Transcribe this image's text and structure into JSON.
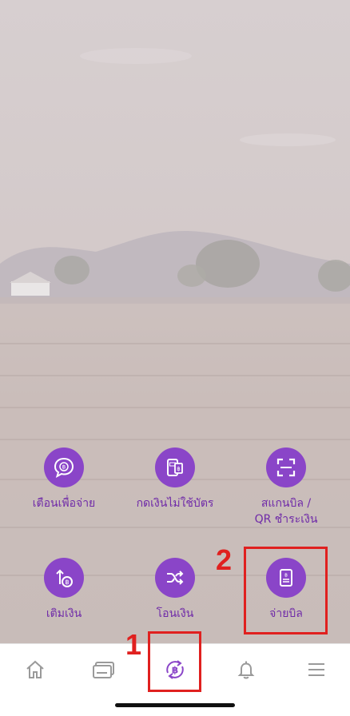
{
  "actions": {
    "remind_pay": "เตือนเพื่อจ่าย",
    "cardless_withdraw": "กดเงินไม่ใช้บัตร",
    "scan_bill": "สแกนบิล /\nQR ชำระเงิน",
    "top_up": "เติมเงิน",
    "transfer": "โอนเงิน",
    "pay_bill": "จ่ายบิล"
  },
  "annotations": {
    "step1": "1",
    "step2": "2"
  },
  "tabbar": {
    "items": [
      "home-icon",
      "card-icon",
      "baht-exchange-icon",
      "bell-icon",
      "menu-icon"
    ],
    "selected": "baht-exchange-icon"
  },
  "colors": {
    "accent": "#8a45c8",
    "label": "#6f2aa8",
    "annotation": "#e0201f"
  }
}
